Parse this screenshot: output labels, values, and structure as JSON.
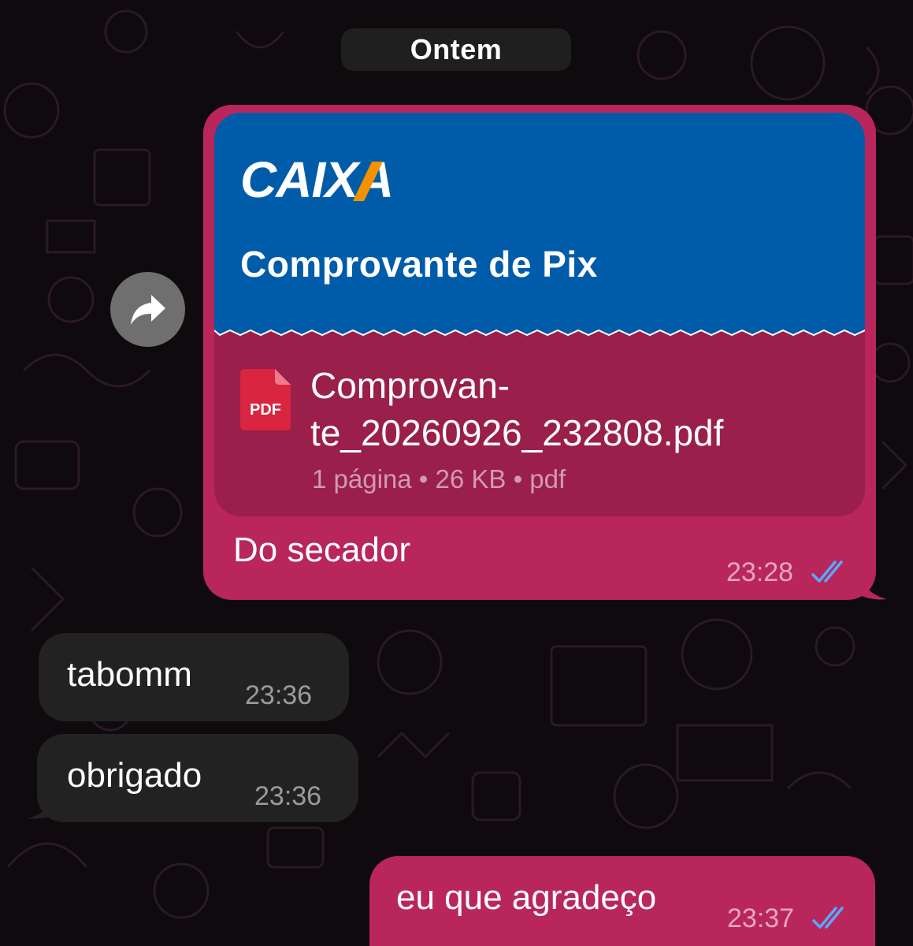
{
  "chat": {
    "date_separator": "Ontem",
    "messages": [
      {
        "direction": "outgoing",
        "type": "document",
        "document": {
          "preview_logo": "CAIXA",
          "preview_title": "Comprovante de Pix",
          "file_name": "Comprovan-te_20260926_232808.pdf",
          "file_name_line1": "Comprovan-",
          "file_name_line2": "te_20260926_232808.pdf",
          "file_icon_label": "PDF",
          "meta": "1 página • 26 KB • pdf"
        },
        "caption": "Do secador",
        "time": "23:28",
        "status": "read"
      },
      {
        "direction": "incoming",
        "text": "tabomm",
        "time": "23:36"
      },
      {
        "direction": "incoming",
        "text": "obrigado",
        "time": "23:36"
      },
      {
        "direction": "outgoing",
        "text": "eu que agradeço",
        "time": "23:37",
        "status": "read"
      }
    ]
  },
  "colors": {
    "outgoing_bubble": "#b8265c",
    "incoming_bubble": "#222222",
    "read_ticks": "#5aa7ff",
    "caixa_blue": "#005ca9",
    "caixa_orange": "#f39200"
  },
  "icons": {
    "forward": "forward-arrow-icon",
    "pdf": "pdf-file-icon",
    "read_receipt": "double-check-icon"
  }
}
